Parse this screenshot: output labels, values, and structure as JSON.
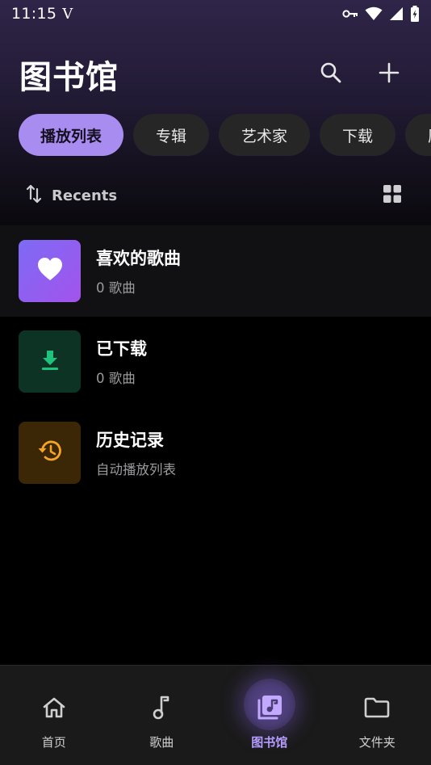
{
  "status_bar": {
    "time": "11:15",
    "indicator": "V",
    "icons": [
      "key-icon",
      "wifi-icon",
      "signal-icon",
      "battery-charging-icon"
    ]
  },
  "header": {
    "title": "图书馆",
    "actions": [
      "search-icon",
      "plus-icon"
    ]
  },
  "chips": [
    {
      "label": "播放列表",
      "active": true
    },
    {
      "label": "专辑",
      "active": false
    },
    {
      "label": "艺术家",
      "active": false
    },
    {
      "label": "下载",
      "active": false
    },
    {
      "label": "历",
      "active": false
    }
  ],
  "sort_bar": {
    "label": "Recents",
    "sort_icon": "sort-arrows-icon",
    "view_icon": "grid-view-icon"
  },
  "list": [
    {
      "title": "喜欢的歌曲",
      "subtitle": "0 歌曲",
      "icon": "heart-icon",
      "color": "#8a5cf0"
    },
    {
      "title": "已下载",
      "subtitle": "0 歌曲",
      "icon": "download-icon",
      "color": "#1fc27d"
    },
    {
      "title": "历史记录",
      "subtitle": "自动播放列表",
      "icon": "history-icon",
      "color": "#f5a524"
    }
  ],
  "bottom_nav": [
    {
      "label": "首页",
      "icon": "home-icon",
      "active": false
    },
    {
      "label": "歌曲",
      "icon": "music-note-icon",
      "active": false
    },
    {
      "label": "图书馆",
      "icon": "library-music-icon",
      "active": true
    },
    {
      "label": "文件夹",
      "icon": "folder-icon",
      "active": false
    }
  ],
  "colors": {
    "accent": "#a88cf0",
    "nav_active": "#b69cff",
    "background": "#000000"
  }
}
